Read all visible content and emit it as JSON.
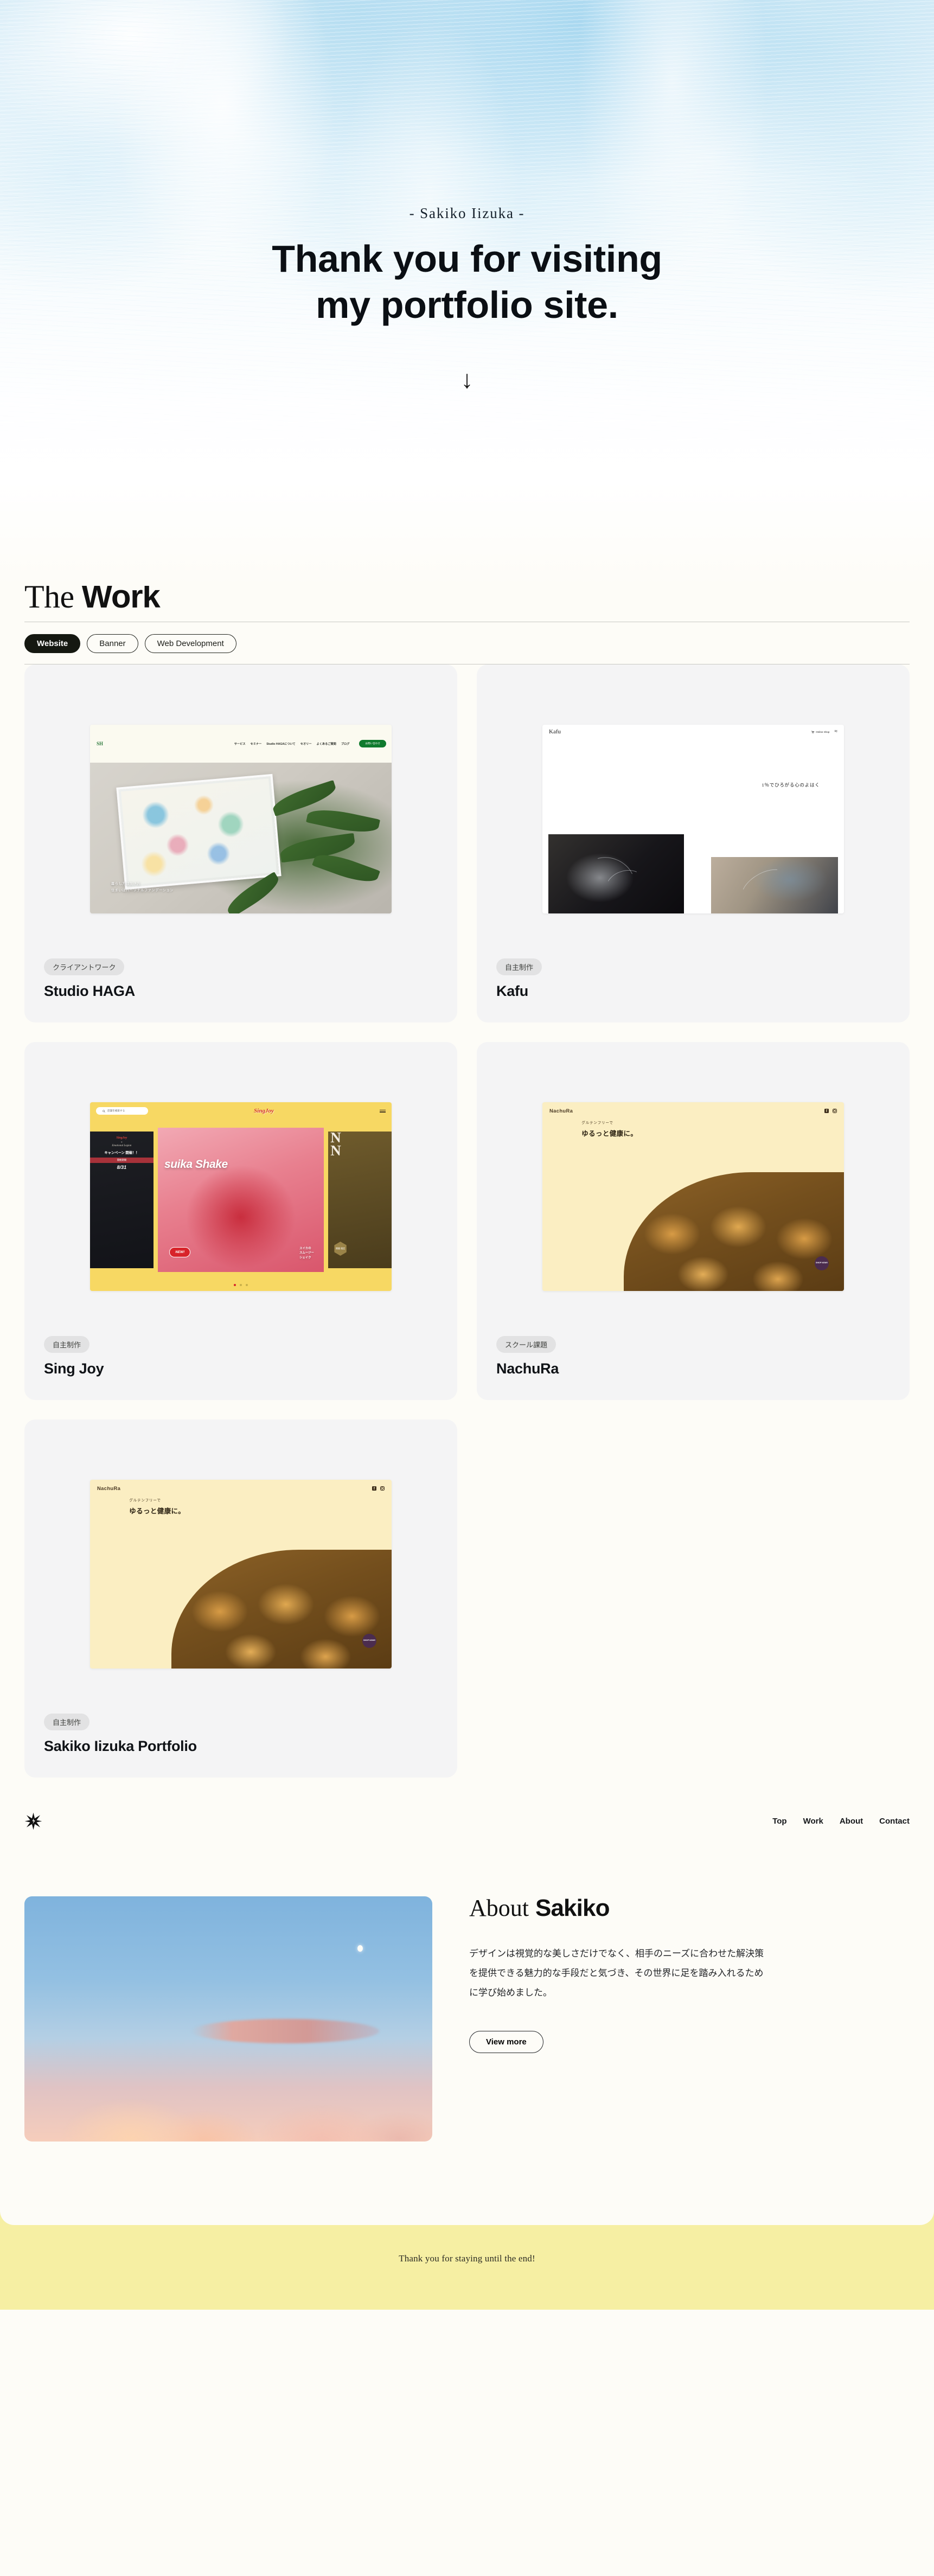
{
  "hero": {
    "eyebrow": "- Sakiko Iizuka -",
    "title_line1": "Thank you for visiting",
    "title_line2": "my portfolio site.",
    "scroll_arrow": "↓"
  },
  "work": {
    "heading_serif": "The",
    "heading_sans": "Work",
    "filters": [
      {
        "label": "Website",
        "active": true
      },
      {
        "label": "Banner",
        "active": false
      },
      {
        "label": "Web Development",
        "active": false
      }
    ],
    "cards": [
      {
        "tag": "クライアントワーク",
        "title": "Studio HAGA",
        "mock": {
          "logo": "SH",
          "nav": [
            "サービス",
            "セミナー",
            "Studio HAGAについて",
            "セオリー",
            "よくあるご質問",
            "ブログ"
          ],
          "cta": "お問い合わせ",
          "caption_line1": "暮らし方は生き方",
          "caption_line2": "住まいはパーソナルファンデーション"
        }
      },
      {
        "tag": "自主制作",
        "title": "Kafu",
        "mock": {
          "logo": "Kafu",
          "shop_label": "Online Shop",
          "tagline": "1％でひろがる心のよはく"
        }
      },
      {
        "tag": "自主制作",
        "title": "Sing Joy",
        "mock": {
          "search_placeholder": "店舗を検索する",
          "logo": "SingJoy",
          "hero_text": "suika Shake",
          "badge": "NEW!",
          "sub_line1": "スイカの",
          "sub_line2": "スムージー",
          "sub_line3": "シェイク",
          "side_logo": "SingJoy",
          "side_x": "×",
          "side_partner": "Emotional Legion",
          "side_campaign": "キャンペーン 開催！！",
          "side_band": "開催期間",
          "side_date_num": "8",
          "side_date_den": "31",
          "side_right_letter": "N",
          "side_right_hex": "期間 限定"
        }
      },
      {
        "tag": "スクール課題",
        "title": "NachuRa",
        "mock": {
          "logo": "NachuRa",
          "copy_line1": "グルテンフリーで",
          "copy_line2": "ゆるっと健康に。",
          "badge": "SHOP NOW!!"
        }
      },
      {
        "tag": "自主制作",
        "title": "Sakiko Iizuka Portfolio",
        "mock": {
          "logo": "NachuRa",
          "copy_line1": "グルテンフリーで",
          "copy_line2": "ゆるっと健康に。",
          "badge": "SHOP NOW!!"
        }
      }
    ]
  },
  "footer_nav": {
    "logo_icon": "sparkle-star-icon",
    "links": [
      "Top",
      "Work",
      "About",
      "Contact"
    ]
  },
  "about": {
    "title_serif": "About",
    "title_sans": "Sakiko",
    "body": "デザインは視覚的な美しさだけでなく、相手のニーズに合わせた解決策を提供できる魅力的な手段だと気づき、その世界に足を踏み入れるために学び始めました。",
    "button": "View more",
    "image_alt": "sunset-sky-with-moon"
  },
  "bottom": {
    "message": "Thank you for staying until the end!"
  },
  "colors": {
    "accent_yellow": "#f6efa3",
    "card_bg": "#f4f4f5",
    "page_bg": "#fdfcf7",
    "pill_active": "#151811",
    "haga_green": "#0f7a2e",
    "sing_yellow": "#f7d863",
    "nachu_cream": "#fbeec2"
  }
}
